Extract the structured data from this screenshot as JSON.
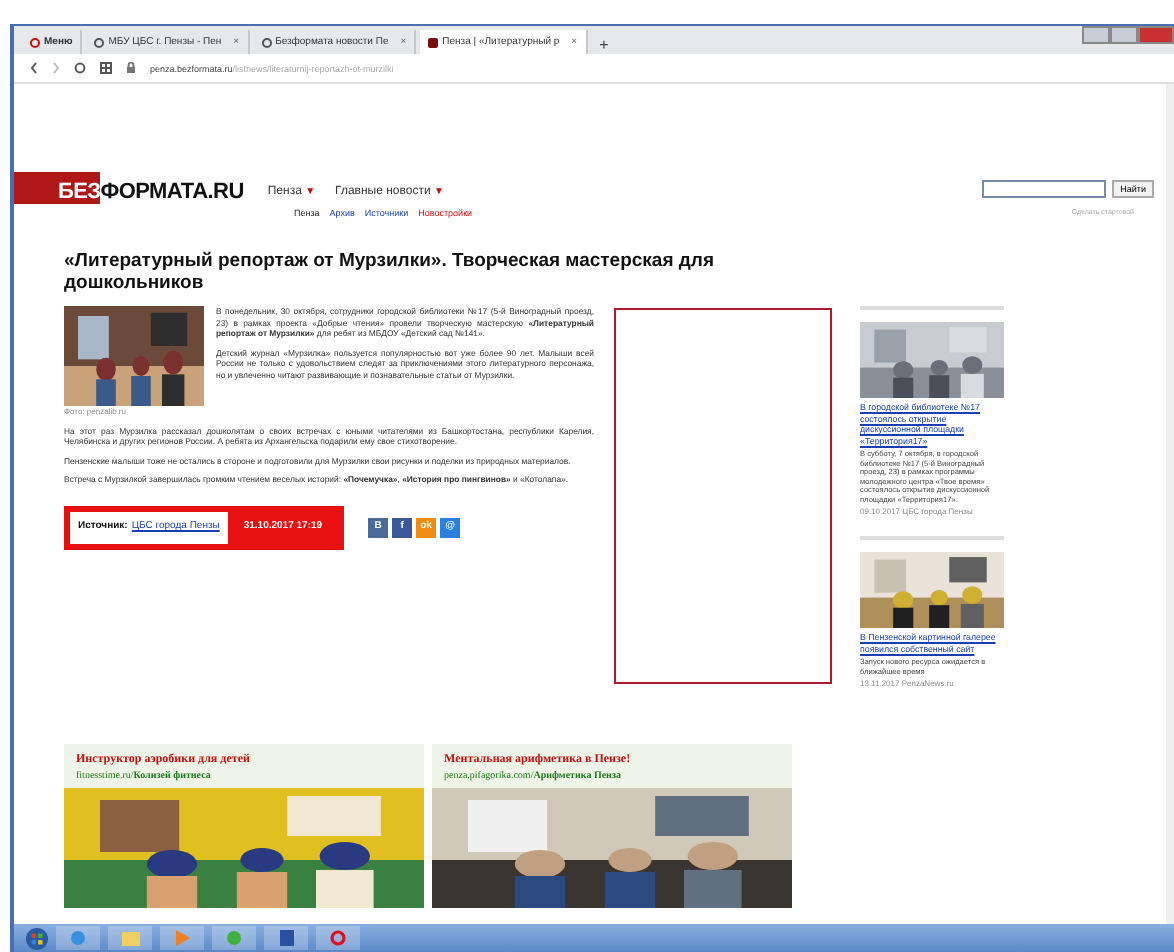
{
  "browser": {
    "tabs": [
      {
        "label": "Меню",
        "selected": false,
        "kind": "menu"
      },
      {
        "label": "МБУ ЦБС г. Пензы - Пен",
        "selected": false,
        "kind": "page"
      },
      {
        "label": "Безформата новости Пе",
        "selected": false,
        "kind": "page"
      },
      {
        "label": "Пенза | «Литературный р",
        "selected": true,
        "kind": "page"
      }
    ],
    "close_mark": "×",
    "new_tab": "+",
    "address": {
      "host": "penza.bezformata.ru",
      "path": "/listnews/literaturnij-reportazh-ot-murzilki"
    }
  },
  "site": {
    "logo_mark": "БЕЗ",
    "logo_rest": "ФОРМАТА.RU",
    "nav": [
      {
        "label": "Пенза",
        "caret": "▼"
      },
      {
        "label": "Главные новости",
        "caret": "▼"
      }
    ],
    "subnav": [
      {
        "label": "Пенза",
        "kind": "current"
      },
      {
        "label": "Архив",
        "kind": "link"
      },
      {
        "label": "Источники",
        "kind": "link"
      },
      {
        "label": "Новостройки",
        "kind": "promo"
      }
    ],
    "search": {
      "button": "Найти"
    },
    "start_link": "Сделать стартовой"
  },
  "article": {
    "title": "«Литературный репортаж от Мурзилки». Творческая мастерская для дошкольников",
    "photo_caption": "Фото: penzalib.ru",
    "intro": [
      "В понедельник, 30 октября, сотрудники городской библиотеки №17 (5-й Виноградный проезд, 23) в рамках проекта «Добрые чтения» провели творческую мастерскую **«Литературный репортаж от Мурзилки»** для ребят из МБДОУ «Детский сад №141».",
      "Детский журнал «Мурзилка» пользуется популярностью вот уже более 90 лет. Малыши всей России не только с удовольствием следят за приключениями этого литературного персонажа, но и увлеченно читают развивающие и познавательные статьи от Мурзилки."
    ],
    "paragraphs": [
      "На этот раз Мурзилка рассказал дошколятам о своих встречах с юными читателями из Башкортостана, республики Карелия, Челябинска и других регионов России. А ребята из Архангельска подарили ему свое стихотворение.",
      "Пензенские малыши тоже не остались в стороне и подготовили для Мурзилки свои рисунки и поделки из природных материалов.",
      "Встреча с Мурзилкой завершилась громким чтением веселых историй: **«Почемучка»**, **«История про пингвинов»** и «Котолапа»."
    ],
    "source_label": "Источник:",
    "source": "ЦБС города Пензы",
    "datetime": "31.10.2017  17:19",
    "share": [
      {
        "kind": "vk",
        "label": "B"
      },
      {
        "kind": "facebook",
        "label": "f"
      },
      {
        "kind": "ok",
        "label": "ok"
      },
      {
        "kind": "mail",
        "label": "@"
      }
    ]
  },
  "sidebar": [
    {
      "title": "В городской библиотеке №17 состоялось открытие дискуссионной площадки «Территория17»",
      "text": "В субботу, 7 октября, в городской библиотеке №17 (5-й Виноградный проезд, 23) в рамках программы молодежного центра «Твое время» состоялось открытие дискуссионной площадки «Территория17».",
      "meta": "09.10.2017 ЦБС города Пензы"
    },
    {
      "title": "В Пензенской картинной галерее появился собственный сайт",
      "text": "Запуск нового ресурса ожидается в ближайшее время",
      "meta": "13.11.2017 PenzaNews.ru"
    }
  ],
  "ads": [
    {
      "title": "Инструктор аэробики для детей",
      "url_host": "fitnesstime.ru/",
      "url_path": "Колизей фитнеса"
    },
    {
      "title": "Ментальная арифметика в Пензе!",
      "url_host": "penza.pifagorika.com/",
      "url_path": "Арифметика Пенза"
    }
  ]
}
